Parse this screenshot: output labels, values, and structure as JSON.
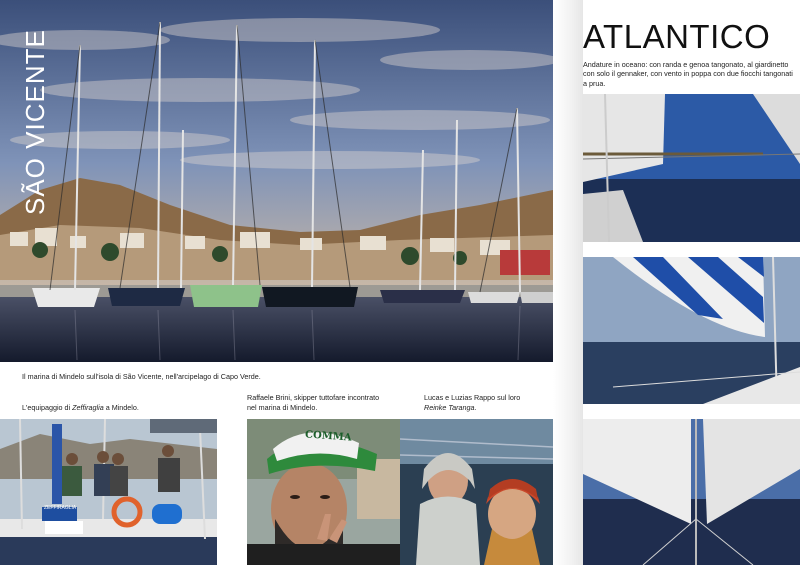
{
  "left_page": {
    "vertical_title": "SÃO VICENTE",
    "main_caption": "Il marina di Mindelo sull'isola di São Vicente, nell'arcipelago di Capo Verde.",
    "caption_crew_prefix": "L'equipaggio di ",
    "caption_crew_boat": "Zeffiraglia",
    "caption_crew_suffix": " a Mindelo.",
    "caption_skipper": "Raffaele Brini,  skipper tuttofare incontrato nel marina di Mindelo.",
    "caption_couple_prefix": "Lucas e Luzias Rappo sul loro ",
    "caption_couple_boat": "Reinke Taranga",
    "caption_couple_suffix": ".",
    "boat_name_text": "ZEFFIRAGLIA",
    "cap_text": "COMMA"
  },
  "right_page": {
    "title": "ATLANTICO",
    "intro": "Andature in oceano: con randa e genoa tangonato, al giardinetto con solo il gennaker, con vento in poppa con due fiocchi tangonati a prua."
  },
  "colors": {
    "sea_dark": "#1d2a45",
    "sky_blue": "#3d6fb5",
    "gennaker_blue": "#1f4ea8",
    "sail_white": "#eeeeee"
  }
}
